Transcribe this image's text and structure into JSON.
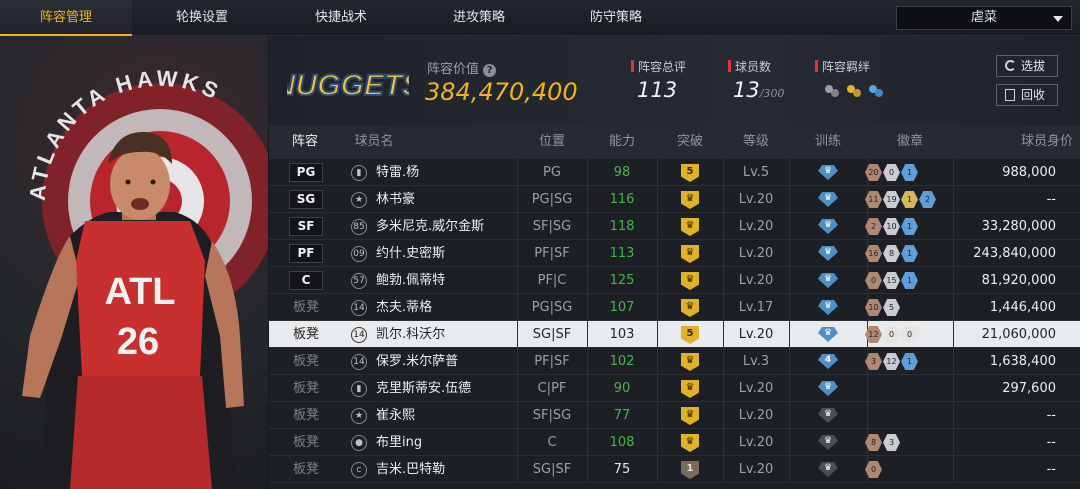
{
  "nav": {
    "tabs": [
      "阵容管理",
      "轮换设置",
      "快捷战术",
      "进攻策略",
      "防守策略"
    ],
    "active_tab": 0,
    "team_select": "虐菜"
  },
  "player_card": {
    "banner_text": "ATLANTA HAWKS",
    "jersey_team": "ATL",
    "jersey_number": "26"
  },
  "header": {
    "team_logo": "NUGGETS",
    "lineup_value_label": "阵容价值",
    "lineup_value": "384,470,400",
    "rating_label": "阵容总评",
    "rating_value": "113",
    "count_label": "球员数",
    "count_value": "13",
    "count_max": "/300",
    "bond_label": "阵容羁绊",
    "select_button": "选拔",
    "recycle_button": "回收"
  },
  "table": {
    "columns": [
      "阵容",
      "球员名",
      "位置",
      "能力",
      "突破",
      "等级",
      "训练",
      "徽章",
      "球员身价"
    ],
    "colors": {
      "ability_green": "#45b74a",
      "accent": "#f0b323"
    },
    "rows": [
      {
        "lineup": "PG",
        "starter": true,
        "icon": "signal",
        "name": "特雷.杨",
        "pos": "PG",
        "ability": "98",
        "break": "5",
        "level": "Lv.5",
        "train": "emblem",
        "badges": [
          [
            "20",
            "bronze"
          ],
          [
            "0",
            "silver"
          ],
          [
            "1",
            "blue"
          ]
        ],
        "value": "988,000"
      },
      {
        "lineup": "SG",
        "starter": true,
        "icon": "star",
        "name": "林书豪",
        "pos": "PG|SG",
        "ability": "116",
        "break": "crown",
        "level": "Lv.20",
        "train": "emblem",
        "badges": [
          [
            "11",
            "bronze"
          ],
          [
            "19",
            "silver"
          ],
          [
            "1",
            "gold"
          ],
          [
            "2",
            "blue"
          ]
        ],
        "value": "--"
      },
      {
        "lineup": "SF",
        "starter": true,
        "icon": "85",
        "name": "多米尼克.威尔金斯",
        "pos": "SF|SG",
        "ability": "118",
        "break": "crown",
        "level": "Lv.20",
        "train": "emblem",
        "badges": [
          [
            "2",
            "bronze"
          ],
          [
            "10",
            "silver"
          ],
          [
            "1",
            "blue"
          ]
        ],
        "value": "33,280,000"
      },
      {
        "lineup": "PF",
        "starter": true,
        "icon": "09",
        "name": "约什.史密斯",
        "pos": "PF|SF",
        "ability": "113",
        "break": "crown",
        "level": "Lv.20",
        "train": "emblem",
        "badges": [
          [
            "16",
            "bronze"
          ],
          [
            "8",
            "silver"
          ],
          [
            "1",
            "blue"
          ]
        ],
        "value": "243,840,000"
      },
      {
        "lineup": "C",
        "starter": true,
        "icon": "57",
        "name": "鲍勃.佩蒂特",
        "pos": "PF|C",
        "ability": "125",
        "break": "crown",
        "level": "Lv.20",
        "train": "emblem",
        "badges": [
          [
            "0",
            "bronze"
          ],
          [
            "15",
            "silver"
          ],
          [
            "1",
            "blue"
          ]
        ],
        "value": "81,920,000"
      },
      {
        "lineup": "板凳",
        "starter": false,
        "icon": "14",
        "name": "杰夫.蒂格",
        "pos": "PG|SG",
        "ability": "107",
        "break": "crown",
        "level": "Lv.17",
        "train": "emblem",
        "badges": [
          [
            "10",
            "bronze"
          ],
          [
            "5",
            "silver"
          ]
        ],
        "value": "1,446,400"
      },
      {
        "lineup": "板凳",
        "starter": false,
        "highlight": true,
        "icon": "14",
        "name": "凯尔.科沃尔",
        "pos": "SG|SF",
        "ability": "103",
        "break": "5",
        "level": "Lv.20",
        "train": "emblem",
        "badges": [
          [
            "12",
            "bronze"
          ],
          [
            "0",
            "white"
          ],
          [
            "0",
            "white"
          ]
        ],
        "value": "21,060,000"
      },
      {
        "lineup": "板凳",
        "starter": false,
        "icon": "14",
        "name": "保罗.米尔萨普",
        "pos": "PF|SF",
        "ability": "102",
        "break": "crown",
        "level": "Lv.3",
        "train": "4",
        "badges": [
          [
            "3",
            "bronze"
          ],
          [
            "12",
            "silver"
          ],
          [
            "1",
            "blue"
          ]
        ],
        "value": "1,638,400"
      },
      {
        "lineup": "板凳",
        "starter": false,
        "icon": "signal",
        "name": "克里斯蒂安.伍德",
        "pos": "C|PF",
        "ability": "90",
        "break": "crown",
        "level": "Lv.20",
        "train": "emblem",
        "badges": [],
        "value": "297,600"
      },
      {
        "lineup": "板凳",
        "starter": false,
        "icon": "star",
        "name": "崔永熙",
        "pos": "SF|SG",
        "ability": "77",
        "break": "crown",
        "level": "Lv.20",
        "train": "dim",
        "badges": [],
        "value": "--"
      },
      {
        "lineup": "板凳",
        "starter": false,
        "icon": "person",
        "name": "布里ing",
        "pos": "C",
        "ability": "108",
        "break": "crown",
        "level": "Lv.20",
        "train": "dim",
        "badges": [
          [
            "8",
            "bronze"
          ],
          [
            "3",
            "silver"
          ]
        ],
        "value": "--"
      },
      {
        "lineup": "板凳",
        "starter": false,
        "icon": "COPY",
        "name": "吉米.巴特勒",
        "pos": "SG|SF",
        "ability": "75",
        "break": "1",
        "level": "Lv.20",
        "train": "dim",
        "badges": [
          [
            "0",
            "bronze"
          ]
        ],
        "value": "--"
      }
    ]
  }
}
